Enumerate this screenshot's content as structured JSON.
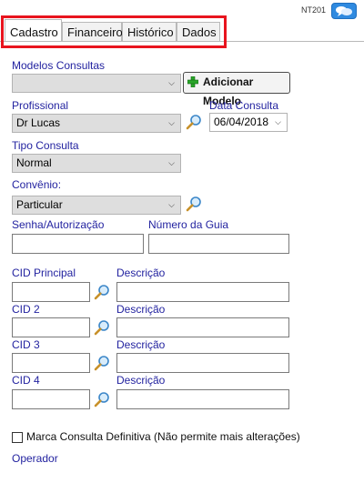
{
  "header": {
    "code": "NT201"
  },
  "tabs": [
    {
      "label": "Cadastro",
      "active": true
    },
    {
      "label": "Financeiro",
      "active": false
    },
    {
      "label": "Histórico",
      "active": false
    },
    {
      "label": "Dados",
      "active": false
    }
  ],
  "form": {
    "modelos_label": "Modelos Consultas",
    "modelos_value": "",
    "add_model_label": "Adicionar Modelo",
    "profissional_label": "Profissional",
    "profissional_value": "Dr Lucas",
    "data_label": "Data Consulta",
    "data_value": "06/04/2018",
    "tipo_label": "Tipo Consulta",
    "tipo_value": "Normal",
    "convenio_label": "Convênio:",
    "convenio_value": "Particular",
    "senha_label": "Senha/Autorização",
    "guia_label": "Número da Guia",
    "cids": [
      {
        "label": "CID Principal",
        "desc_label": "Descrição"
      },
      {
        "label": "CID 2",
        "desc_label": "Descrição"
      },
      {
        "label": "CID 3",
        "desc_label": "Descrição"
      },
      {
        "label": "CID 4",
        "desc_label": "Descrição"
      }
    ],
    "definitiva_label": "Marca Consulta Definitiva (Não permite mais alterações)",
    "operador_label": "Operador"
  },
  "colors": {
    "highlight": "#e8141e",
    "label": "#2323a0",
    "chat_button": "#2f8ae0"
  },
  "icons": {
    "search": "magnifier-icon",
    "add": "green-plus-icon",
    "chat": "chat-bubble-icon"
  }
}
